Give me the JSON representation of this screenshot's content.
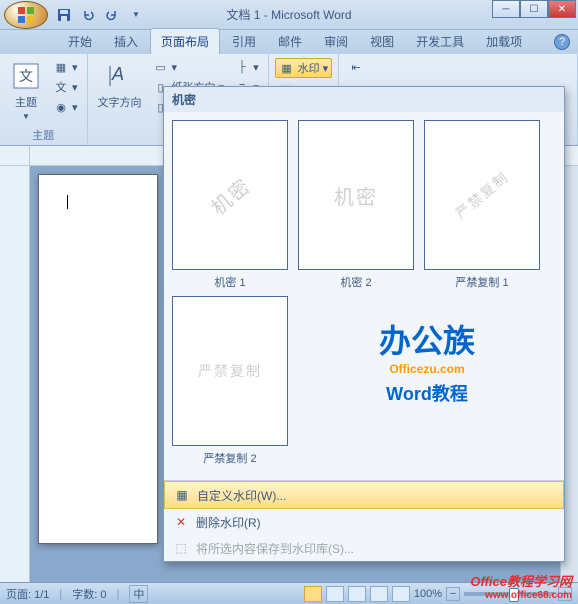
{
  "title": "文档 1 - Microsoft Word",
  "tabs": [
    "开始",
    "插入",
    "页面布局",
    "引用",
    "邮件",
    "审阅",
    "视图",
    "开发工具",
    "加载项"
  ],
  "active_tab_index": 2,
  "ribbon": {
    "theme_group": "主题",
    "theme_btn": "主题",
    "text_dir_btn": "文字方向",
    "paper_dir": "纸张方向",
    "watermark_btn": "水印"
  },
  "gallery": {
    "header": "机密",
    "items": [
      {
        "wm": "机密",
        "label": "机密 1"
      },
      {
        "wm": "机密",
        "label": "机密 2"
      },
      {
        "wm": "严禁复制",
        "label": "严禁复制 1"
      },
      {
        "wm": "严禁复制",
        "label": "严禁复制 2"
      }
    ],
    "custom": "自定义水印(W)...",
    "remove": "删除水印(R)",
    "save": "将所选内容保存到水印库(S)..."
  },
  "logo": {
    "cn": "办公族",
    "en": "Officezu.com",
    "sub": "Word教程"
  },
  "status": {
    "page": "页面: 1/1",
    "words": "字数: 0",
    "lang_icon": "中",
    "zoom": "100%",
    "zoom_minus": "−",
    "zoom_plus": "+"
  },
  "site_wm": {
    "text": "Office教程学习网",
    "url": "www.office68.com"
  }
}
